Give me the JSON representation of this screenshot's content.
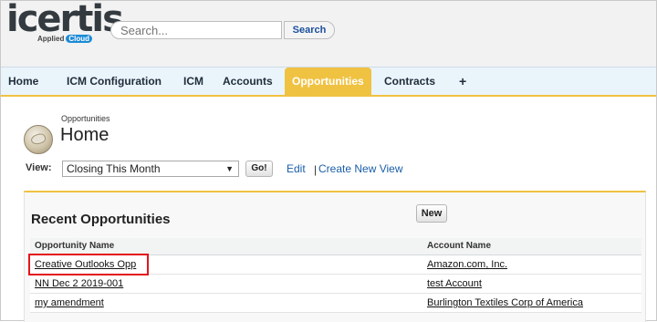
{
  "header": {
    "logo_text": "icertis",
    "logo_sub": "Applied",
    "logo_cloud": "Cloud",
    "search_placeholder": "Search...",
    "search_button": "Search"
  },
  "tabs": [
    {
      "label": "Home"
    },
    {
      "label": "ICM Configuration"
    },
    {
      "label": "ICM"
    },
    {
      "label": "Accounts"
    },
    {
      "label": "Opportunities",
      "active": true
    },
    {
      "label": "Contracts"
    },
    {
      "label": "+"
    }
  ],
  "page": {
    "subtitle": "Opportunities",
    "title": "Home",
    "icon": "opportunities-icon"
  },
  "view": {
    "label": "View:",
    "selected": "Closing This Month",
    "go": "Go!",
    "edit_link": "Edit",
    "separator": "|",
    "create_link": "Create New View"
  },
  "recent": {
    "title": "Recent Opportunities",
    "new_button": "New",
    "columns": [
      "Opportunity Name",
      "Account Name"
    ],
    "rows": [
      {
        "opportunity": "Creative Outlooks Opp",
        "account": "Amazon.com, Inc."
      },
      {
        "opportunity": "NN Dec 2 2019-001",
        "account": "test Account"
      },
      {
        "opportunity": "my amendment",
        "account": "Burlington Textiles Corp of America"
      }
    ]
  },
  "colors": {
    "accent": "#f0c242",
    "tabbar": "#eaf4fb",
    "link": "#1a5ea8",
    "highlight": "#e3141b"
  }
}
